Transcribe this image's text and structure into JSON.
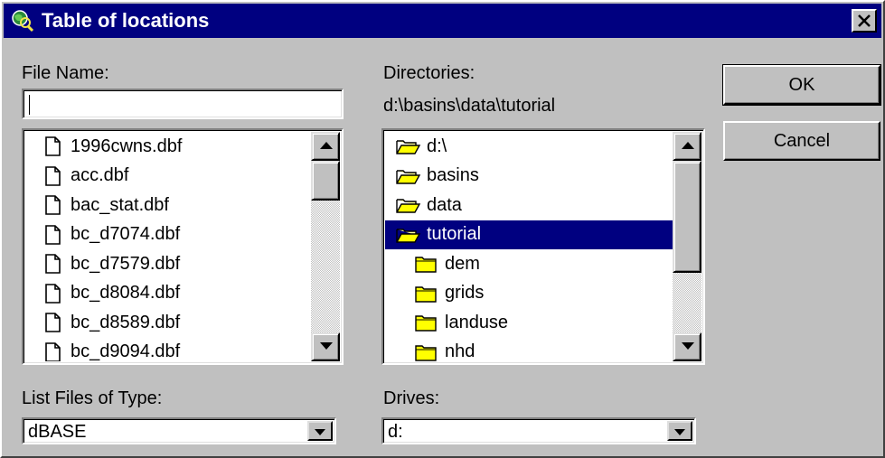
{
  "window": {
    "title": "Table of locations"
  },
  "icons": {
    "app": "globe-magnifier-icon",
    "close": "close-icon",
    "file": "document-icon",
    "folder_open": "open-folder-icon",
    "folder_closed": "folder-icon",
    "scroll_up": "arrow-up-icon",
    "scroll_down": "arrow-down-icon",
    "dropdown": "arrow-down-icon"
  },
  "file_name": {
    "label": "File Name:",
    "value": ""
  },
  "files": [
    "1996cwns.dbf",
    "acc.dbf",
    "bac_stat.dbf",
    "bc_d7074.dbf",
    "bc_d7579.dbf",
    "bc_d8084.dbf",
    "bc_d8589.dbf",
    "bc_d9094.dbf"
  ],
  "directories": {
    "label": "Directories:",
    "current_path": "d:\\basins\\data\\tutorial",
    "items": [
      {
        "name": "d:\\",
        "icon": "open-folder-icon",
        "selected": false
      },
      {
        "name": "basins",
        "icon": "open-folder-icon",
        "selected": false
      },
      {
        "name": "data",
        "icon": "open-folder-icon",
        "selected": false
      },
      {
        "name": "tutorial",
        "icon": "open-folder-icon",
        "selected": true
      },
      {
        "name": "dem",
        "icon": "folder-icon",
        "selected": false
      },
      {
        "name": "grids",
        "icon": "folder-icon",
        "selected": false
      },
      {
        "name": "landuse",
        "icon": "folder-icon",
        "selected": false
      },
      {
        "name": "nhd",
        "icon": "folder-icon",
        "selected": false
      }
    ]
  },
  "file_type": {
    "label": "List Files of Type:",
    "value": "dBASE"
  },
  "drives": {
    "label": "Drives:",
    "value": "d:"
  },
  "buttons": {
    "ok": "OK",
    "cancel": "Cancel"
  },
  "colors": {
    "face": "#c0c0c0",
    "title_bar": "#000080",
    "selection": "#000080",
    "folder_yellow": "#ffff00"
  }
}
